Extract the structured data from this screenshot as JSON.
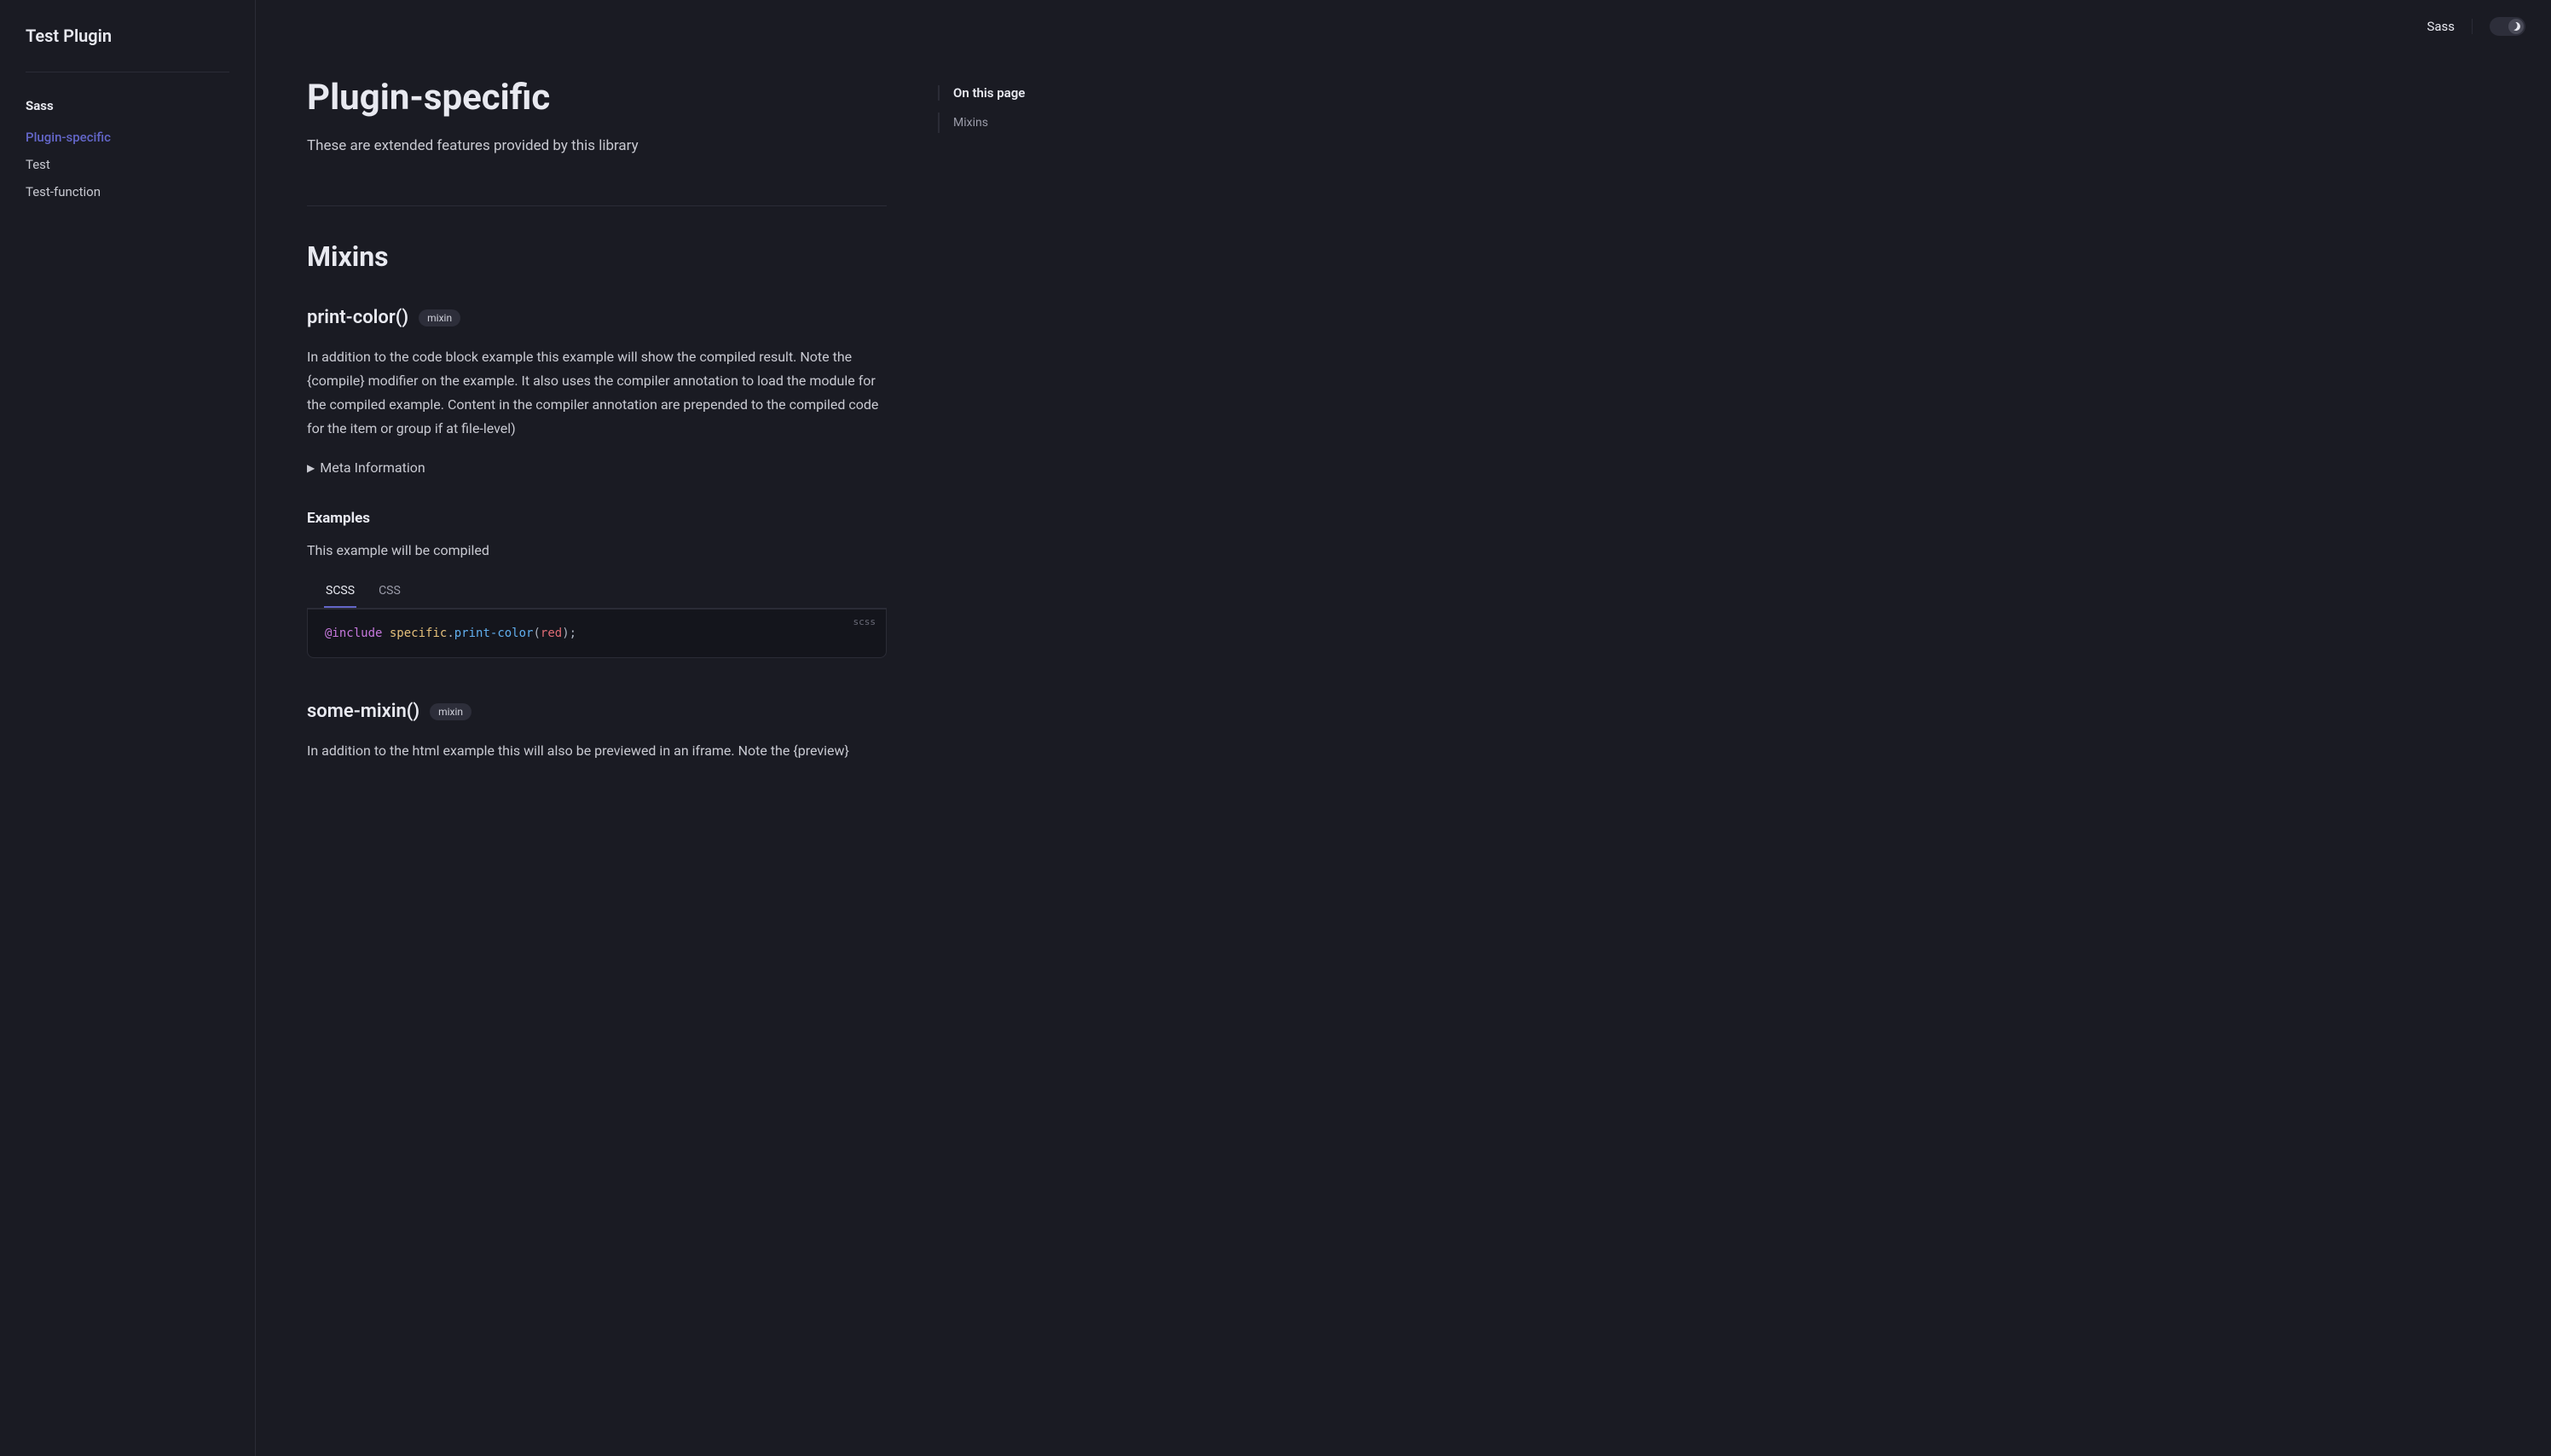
{
  "site_title": "Test Plugin",
  "topbar": {
    "label": "Sass"
  },
  "sidebar": {
    "heading": "Sass",
    "items": [
      {
        "label": "Plugin-specific",
        "active": true
      },
      {
        "label": "Test",
        "active": false
      },
      {
        "label": "Test-function",
        "active": false
      }
    ]
  },
  "page": {
    "title": "Plugin-specific",
    "intro": "These are extended features provided by this library"
  },
  "section": {
    "title": "Mixins"
  },
  "mixin1": {
    "name": "print-color()",
    "badge": "mixin",
    "desc": "In addition to the code block example this example will show the compiled result. Note the {compile} modifier on the example. It also uses the compiler annotation to load the module for the compiled example. Content in the compiler annotation are prepended to the compiled code for the item or group if at file-level)",
    "meta_label": "Meta Information",
    "examples_heading": "Examples",
    "example_caption": "This example will be compiled",
    "tabs": {
      "scss": "SCSS",
      "css": "CSS"
    },
    "code_lang": "scss",
    "code": {
      "at": "@include",
      "mod": "specific",
      "dot": ".",
      "fn": "print-color",
      "open": "(",
      "val": "red",
      "close": ");"
    }
  },
  "mixin2": {
    "name": "some-mixin()",
    "badge": "mixin",
    "desc": "In addition to the html example this will also be previewed in an iframe. Note the {preview}"
  },
  "toc": {
    "title": "On this page",
    "items": [
      {
        "label": "Mixins"
      }
    ]
  }
}
